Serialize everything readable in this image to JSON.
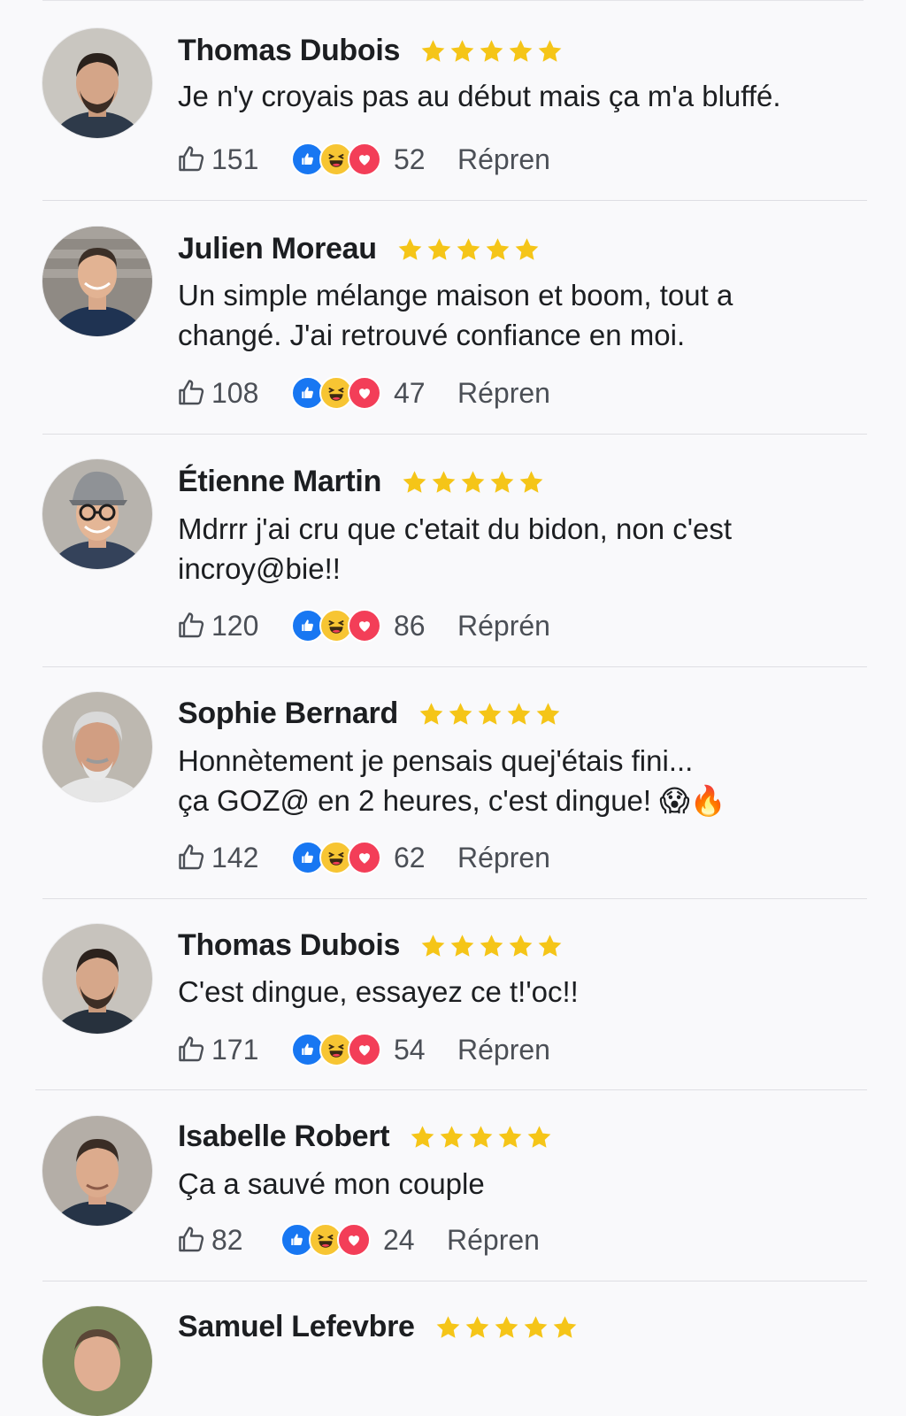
{
  "comments": [
    {
      "name": "Thomas Dubois",
      "text_lines": [
        "Je n'y croyais pas au début mais ça m'a bluffé."
      ],
      "likes": "151",
      "reactions": "52",
      "reply": "Répren",
      "rating": 5
    },
    {
      "name": "Julien Moreau",
      "text_lines": [
        "Un simple mélange maison et boom, tout a",
        "changé. J'ai retrouvé confiance en moi."
      ],
      "likes": "108",
      "reactions": "47",
      "reply": "Répren",
      "rating": 5
    },
    {
      "name": "Étienne Martin",
      "text_lines": [
        "Mdrrr j'ai cru que c'etait du bidon, non c'est",
        "incroy@bie!!"
      ],
      "likes": "120",
      "reactions": "86",
      "reply": "Réprén",
      "rating": 5
    },
    {
      "name": "Sophie Bernard",
      "text_lines": [
        "Honnètement je pensais quej'étais fini...",
        "ça GOZ@ en 2 heures, c'est dingue! 😱🔥"
      ],
      "likes": "142",
      "reactions": "62",
      "reply": "Répren",
      "rating": 5
    },
    {
      "name": "Thomas Dubois",
      "text_lines": [
        "C'est dingue, essayez ce t!'oc!!"
      ],
      "likes": "171",
      "reactions": "54",
      "reply": "Répren",
      "rating": 5
    },
    {
      "name": "Isabelle Robert",
      "text_lines": [
        "Ça a sauvé mon couple"
      ],
      "likes": "82",
      "reactions": "24",
      "reply": "Répren",
      "rating": 5
    },
    {
      "name": "Samuel Lefevbre",
      "text_lines": [],
      "likes": "",
      "reactions": "",
      "reply": "",
      "rating": 5
    }
  ],
  "colors": {
    "star": "#f5c518",
    "like_blue": "#1877f2",
    "haha_yellow": "#f7c533",
    "love_red": "#f33e58",
    "divider": "#dedee3"
  },
  "icons": {
    "like": "thumbs-up-outline-icon",
    "rating": "star-icon",
    "reaction_like": "like-reaction-icon",
    "reaction_haha": "haha-reaction-icon",
    "reaction_love": "love-reaction-icon"
  }
}
